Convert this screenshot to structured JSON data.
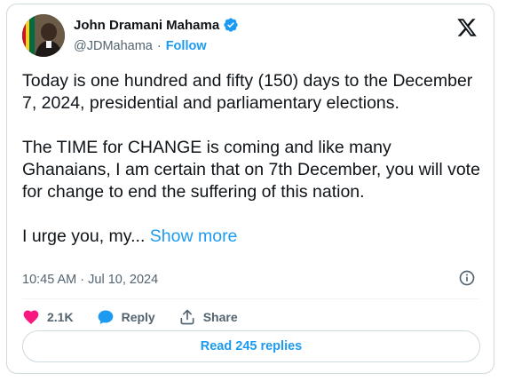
{
  "author": {
    "name": "John Dramani Mahama",
    "handle": "@JDMahama",
    "separator": "·",
    "follow_label": "Follow"
  },
  "tweet": {
    "paragraphs": [
      "Today is one hundred and fifty (150) days to the December 7, 2024, presidential and parliamentary elections.",
      "The TIME for CHANGE is coming and like many Ghanaians, I am certain that on 7th December, you will vote for change to end the suffering of this nation."
    ],
    "truncated_text": "I urge you, my... ",
    "show_more_label": "Show more",
    "timestamp": "10:45 AM · Jul 10, 2024"
  },
  "actions": {
    "like_count": "2.1K",
    "reply_label": "Reply",
    "share_label": "Share"
  },
  "read_replies_label": "Read 245 replies",
  "icons": {
    "verified": "verified-badge-icon",
    "brand": "x-logo-icon",
    "info": "info-icon",
    "like": "heart-icon",
    "reply": "chat-bubble-icon",
    "share": "share-icon"
  },
  "colors": {
    "accent": "#1d9bf0",
    "like": "#f91880",
    "text": "#0f1419",
    "muted": "#536471",
    "border": "#cfd9de"
  }
}
